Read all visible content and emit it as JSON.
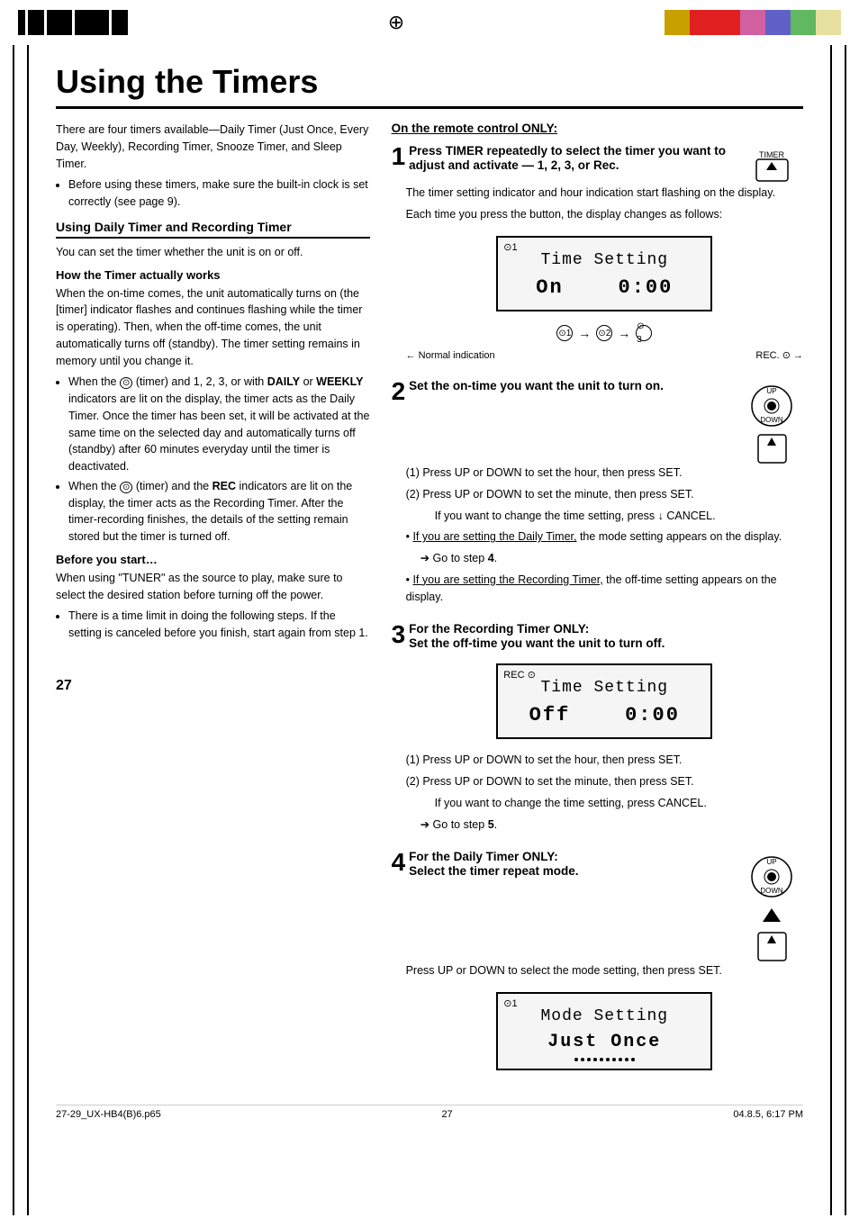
{
  "page": {
    "title": "Using the Timers",
    "page_number": "27",
    "footer_left": "27-29_UX-HB4(B)6.p65",
    "footer_center": "27",
    "footer_right": "04.8.5, 6:17 PM"
  },
  "top_bar": {
    "color_blocks": [
      "#000000",
      "#000000",
      "#000000",
      "#000000",
      "#000000",
      "#c8a000",
      "#e02020",
      "#e02020",
      "#d060a0",
      "#6060c8",
      "#60b860",
      "#e8e0a0"
    ]
  },
  "intro": {
    "paragraph": "There are four timers available—Daily Timer (Just Once, Every Day, Weekly), Recording Timer, Snooze Timer, and Sleep Timer.",
    "bullet": "Before using these timers, make sure the built-in clock is set correctly (see page 9)."
  },
  "section_daily": {
    "heading": "Using Daily Timer and Recording Timer",
    "para1": "You can set the timer whether the unit is on or off.",
    "sub1": "How the Timer actually works",
    "sub1_para": "When the on-time comes, the unit automatically turns on (the [timer] indicator flashes and continues flashing while the timer is operating). Then, when the off-time comes, the unit automatically turns off (standby). The timer setting remains in memory until you change it.",
    "bullets": [
      "When the (timer) and 1, 2, 3, or with DAILY or WEEKLY indicators are lit on the display, the timer acts as the Daily Timer. Once the timer has been set, it will be activated at the same time on the selected day and automatically turns off (standby) after 60 minutes everyday until the timer is deactivated.",
      "When the (timer) and the REC indicators are lit on the display, the timer acts as the Recording Timer. After the timer-recording finishes, the details of the setting remain stored but the timer is turned off."
    ],
    "sub2": "Before you start…",
    "sub2_para": "When using \"TUNER\" as the source to play, make sure to select the desired station before turning off the power.",
    "sub2_bullet": "There is a time limit in doing the following steps. If the setting is canceled before you finish, start again from step 1."
  },
  "right_col": {
    "remote_heading": "On the remote control ONLY:",
    "steps": [
      {
        "num": "1",
        "title": "Press TIMER repeatedly to select the timer you want to adjust and activate — 1, 2, 3, or Rec.",
        "body": "The timer setting indicator and  hour indication start flashing on the display.",
        "body2": "Each time you press the button, the display changes as follows:",
        "display1_indicator": "⊙1",
        "display1_line1": "Time Setting",
        "display1_line2": "On      0:00",
        "arrow_items": [
          "⊙1",
          "⊙2",
          "⊙3"
        ],
        "normal_label": "Normal indication",
        "rec_label": "REC. ⊙"
      },
      {
        "num": "2",
        "title": "Set the on-time you want the unit to turn on.",
        "items": [
          "(1) Press UP or DOWN to set the hour, then press SET.",
          "(2) Press UP or DOWN to set the minute, then press SET.",
          "If you want to change the time setting, press CANCEL."
        ],
        "bullet1": "If you are setting the Daily Timer, the mode setting appears on the display.",
        "bullet1_goto": "➔ Go to step 4.",
        "bullet2": "If you are setting the Recording Timer, the off-time setting appears on the display."
      },
      {
        "num": "3",
        "title": "For the Recording Timer ONLY:",
        "title2": "Set the off-time you want the unit to turn off.",
        "display_indicator": "REC ⊙",
        "display_line1": "Time Setting",
        "display_line2": "Off     0:00",
        "items": [
          "(1) Press UP or DOWN to set the hour, then press SET.",
          "(2) Press UP or DOWN to set the minute, then press SET.",
          "If you want to change the time setting, press CANCEL."
        ],
        "goto": "➔ Go to step 5."
      },
      {
        "num": "4",
        "title": "For the Daily Timer ONLY:",
        "title2": "Select the timer repeat mode.",
        "body": "Press UP or DOWN to select the mode setting, then press SET.",
        "display_indicator": "⊙1",
        "display_line1": "Mode Setting",
        "display_line2": "Just Once"
      }
    ]
  }
}
